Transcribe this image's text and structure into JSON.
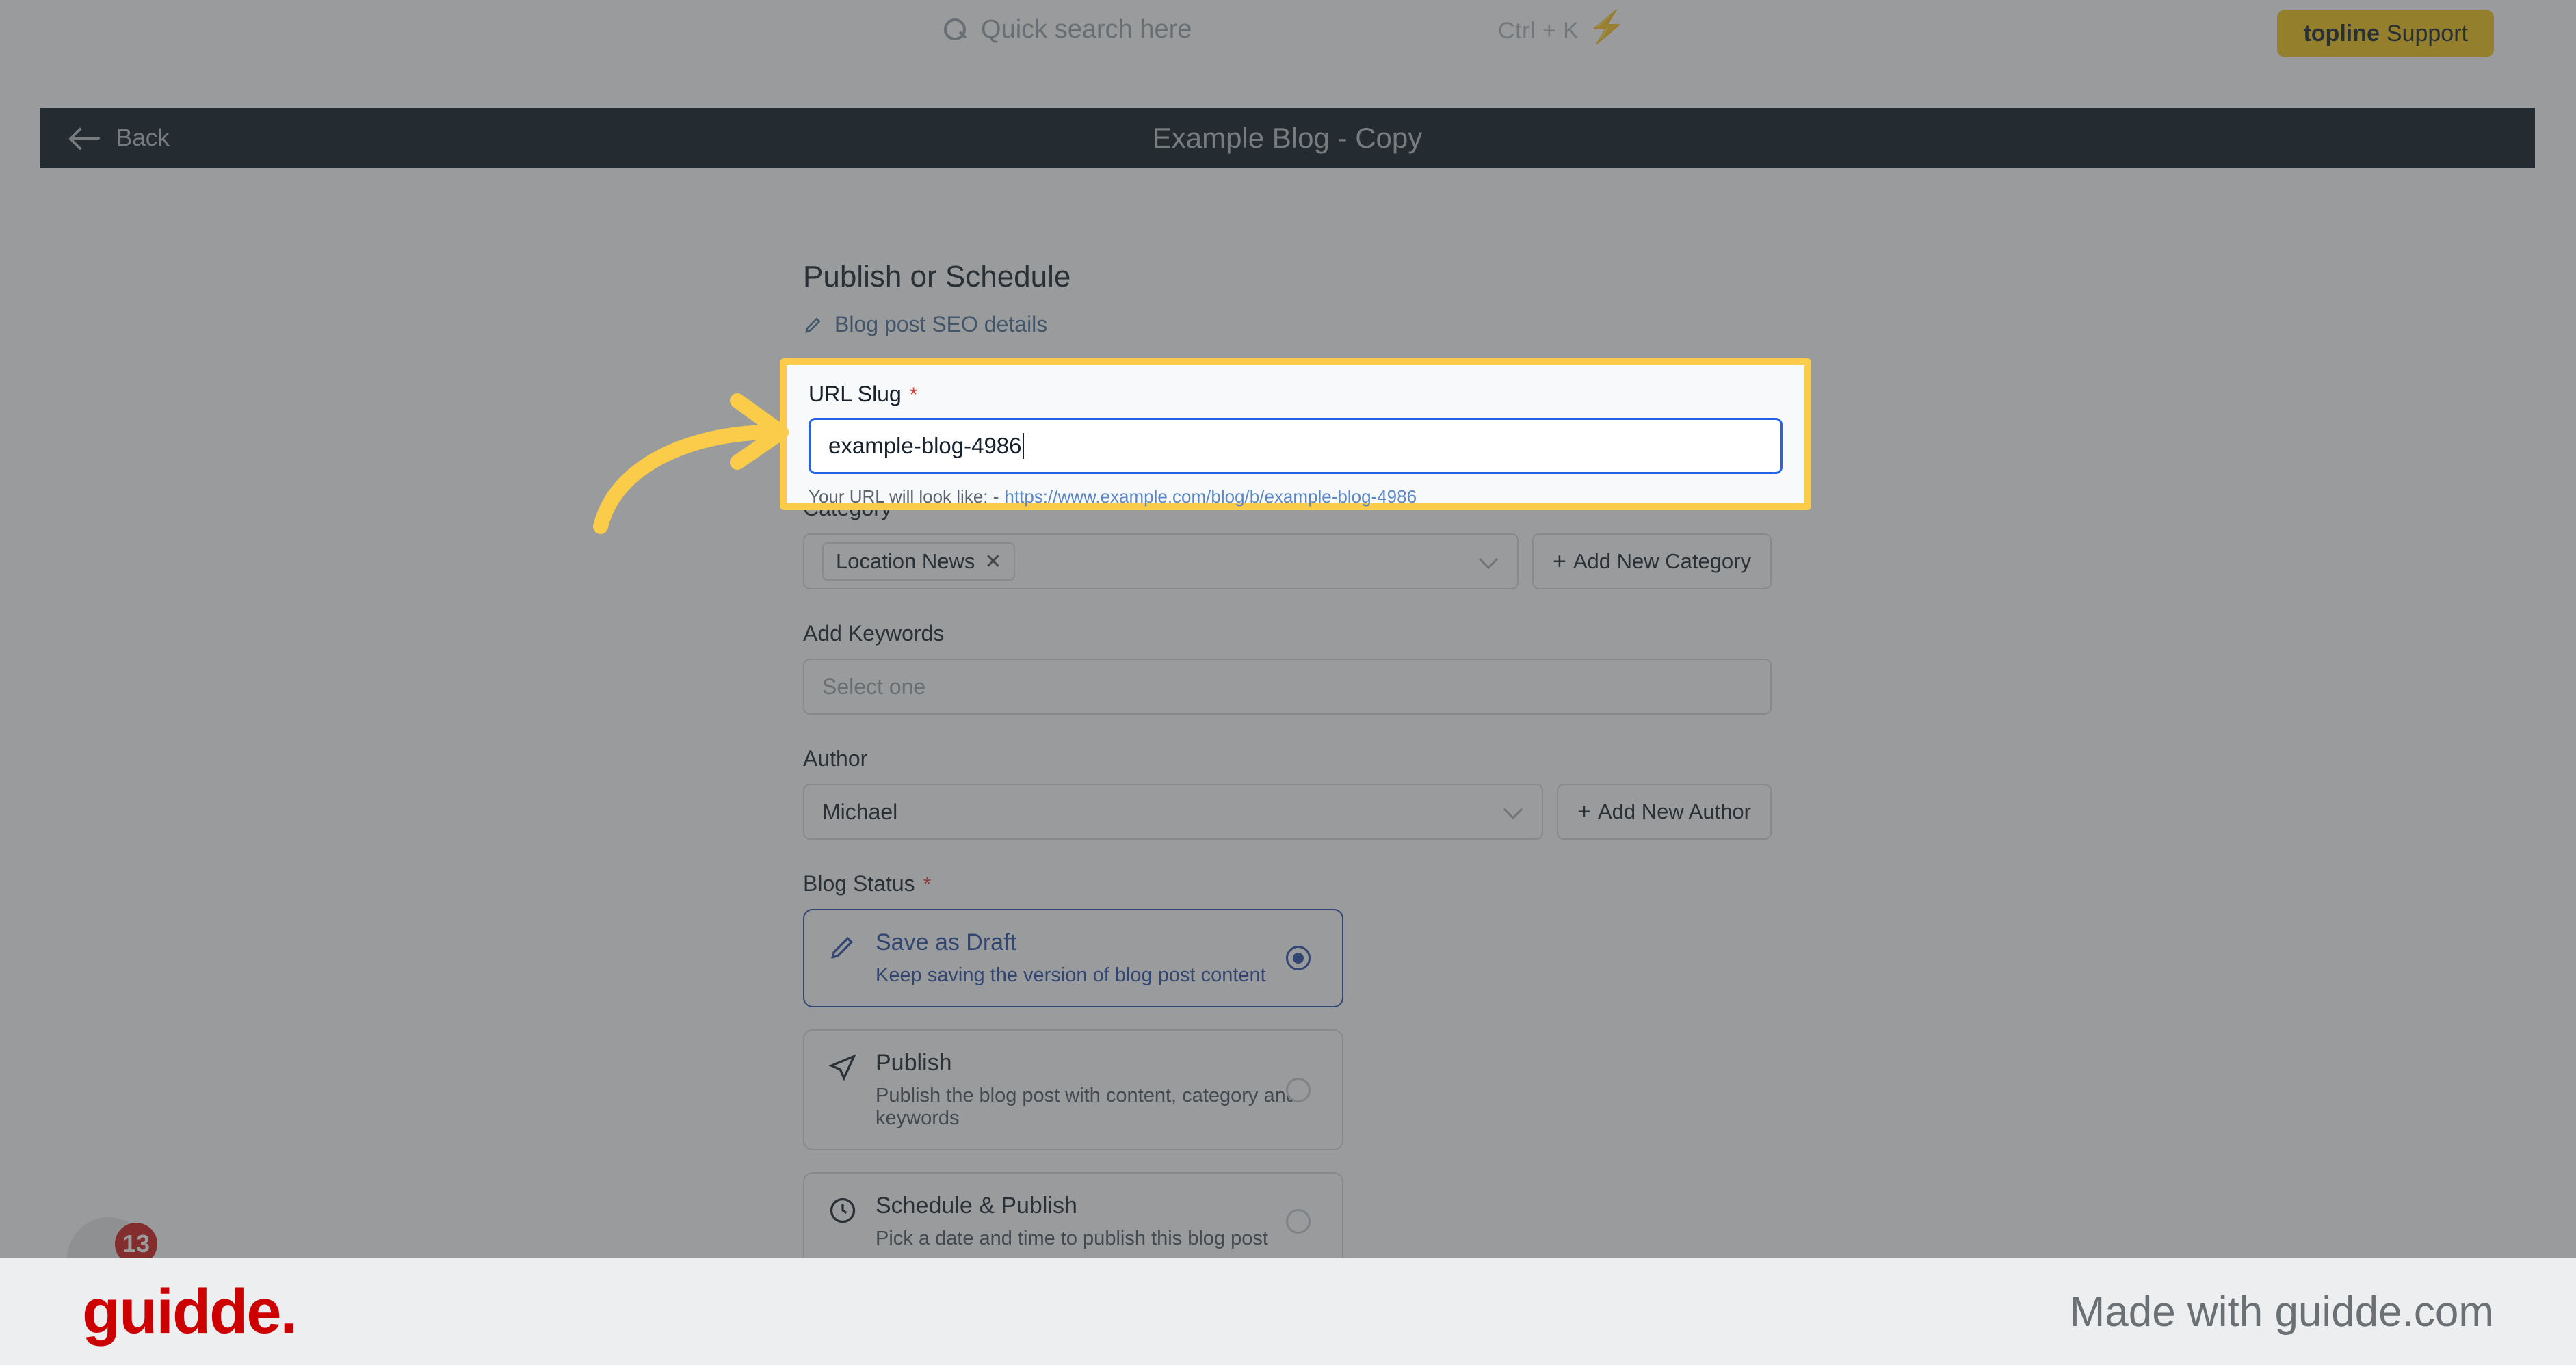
{
  "topbar": {
    "search_placeholder": "Quick search here",
    "search_icon": "search-icon",
    "shortcut_hint": "Ctrl + K",
    "bolt_icon": "lightning-bolt-icon",
    "support_button": {
      "brand": "topline",
      "label": "Support"
    }
  },
  "page_header": {
    "back_label": "Back",
    "back_icon": "arrow-left-icon",
    "title": "Example Blog - Copy"
  },
  "main": {
    "section_title": "Publish or Schedule",
    "seo_link": {
      "label": "Blog post SEO details",
      "icon": "pencil-icon"
    },
    "url_slug": {
      "label": "URL Slug",
      "required_marker": "*",
      "value": "example-blog-4986",
      "help_prefix": "Your URL will look like: -",
      "help_url": "https://www.example.com/blog/b/example-blog-4986"
    },
    "category": {
      "label": "Category",
      "required_marker": "*",
      "tags": [
        "Location News"
      ],
      "tag_remove_icon": "close-icon",
      "chevron_icon": "chevron-down-icon",
      "add_button": "Add New Category"
    },
    "keywords": {
      "label": "Add Keywords",
      "placeholder": "Select one"
    },
    "author": {
      "label": "Author",
      "value": "Michael",
      "chevron_icon": "chevron-down-icon",
      "add_button": "Add New Author"
    },
    "blog_status": {
      "label": "Blog Status",
      "required_marker": "*",
      "options": [
        {
          "title": "Save as Draft",
          "subtitle": "Keep saving the version of blog post content",
          "icon": "pencil-icon",
          "selected": true
        },
        {
          "title": "Publish",
          "subtitle": "Publish the blog post with content, category and keywords",
          "icon": "paper-plane-icon",
          "selected": false
        },
        {
          "title": "Schedule & Publish",
          "subtitle": "Pick a date and time to publish this blog post",
          "icon": "clock-icon",
          "selected": false
        }
      ]
    }
  },
  "chat_widget": {
    "icon": "chat-bubble-icon",
    "badge_count": "13"
  },
  "footer": {
    "brand": "guidde.",
    "made_with": "Made with guidde.com"
  },
  "colors": {
    "highlight": "#fbcc49",
    "accent_blue": "#2563eb",
    "selected_blue": "#2b4ea8",
    "header_dark": "#0d1821",
    "support_yellow": "#f5c518",
    "brand_red": "#cc0000",
    "required_red": "#d8413a"
  }
}
